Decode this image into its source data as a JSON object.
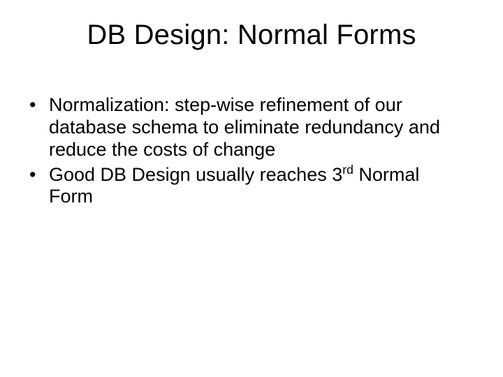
{
  "slide": {
    "title": "DB Design: Normal Forms",
    "bullets": [
      {
        "text": "Normalization: step-wise refinement of our database schema to eliminate redundancy and reduce the costs of change"
      },
      {
        "prefix": "Good DB Design usually reaches 3",
        "sup": "rd",
        "suffix": " Normal Form"
      }
    ]
  }
}
